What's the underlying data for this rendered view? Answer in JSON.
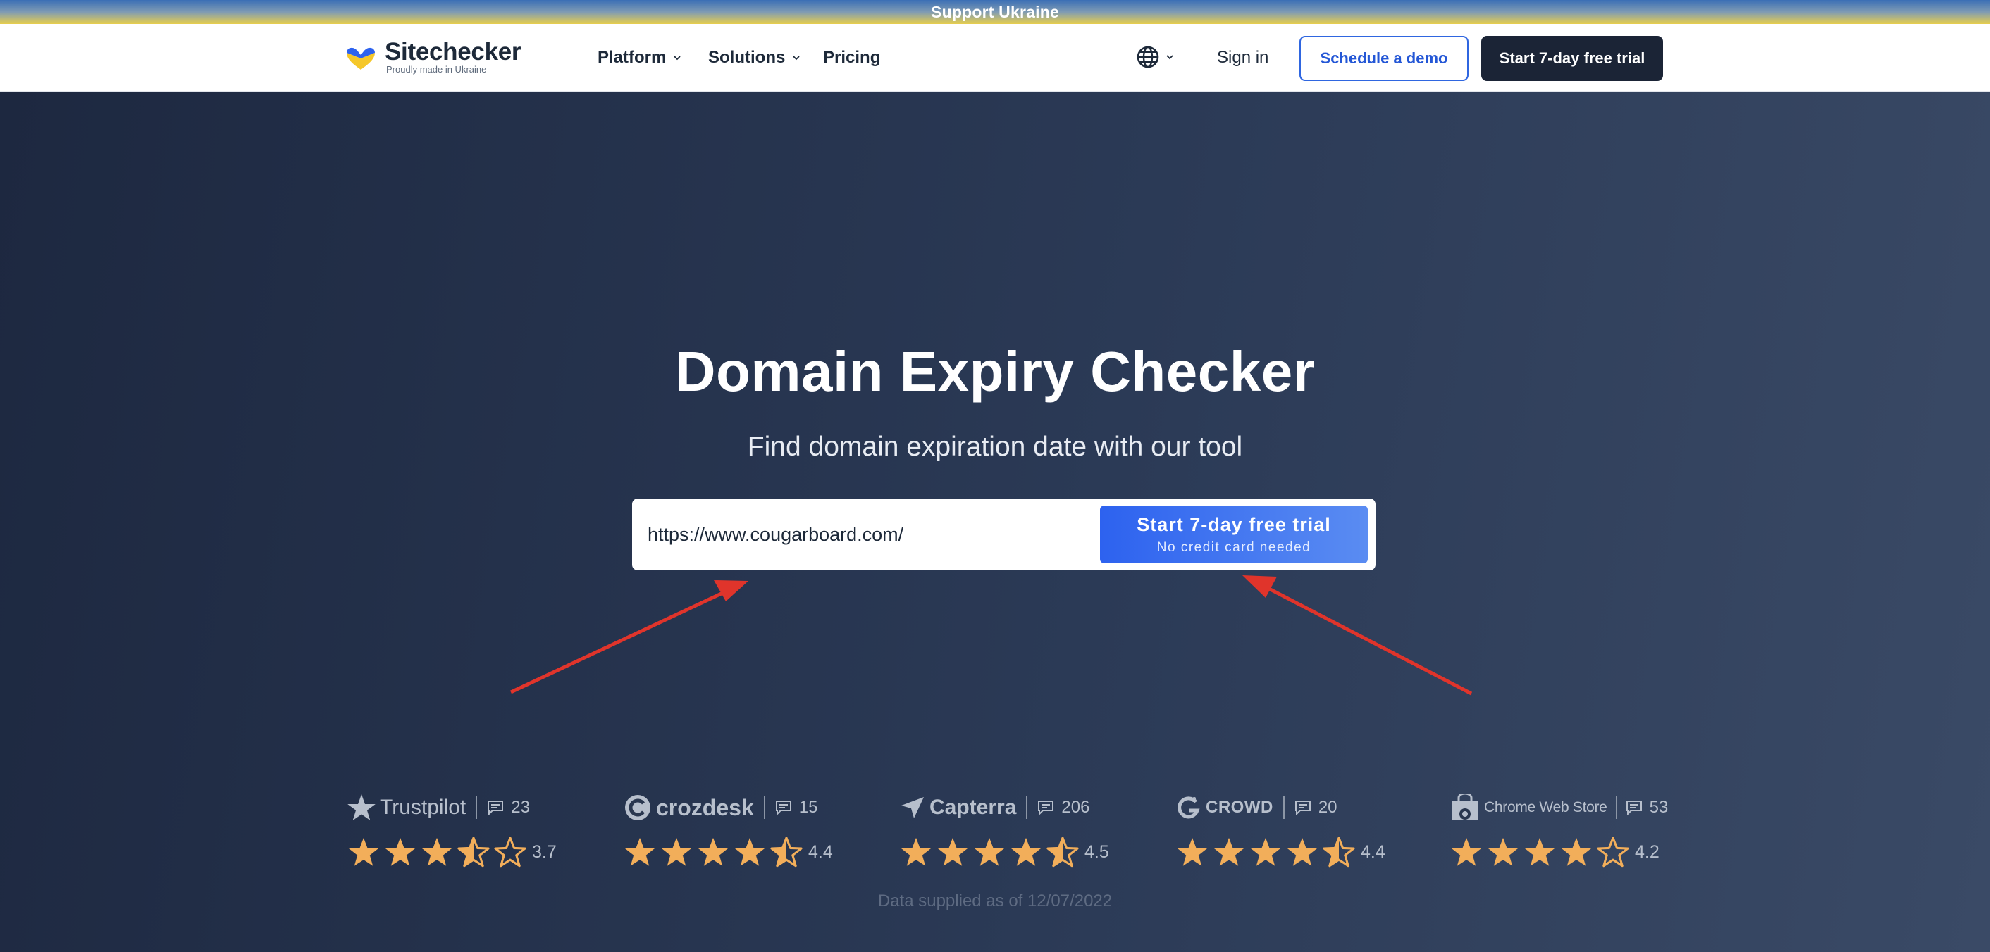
{
  "banner": {
    "text": "Support Ukraine"
  },
  "header": {
    "logo_name": "Sitechecker",
    "logo_tagline": "Proudly made in Ukraine",
    "nav": [
      {
        "label": "Platform",
        "has_dropdown": true
      },
      {
        "label": "Solutions",
        "has_dropdown": true
      },
      {
        "label": "Pricing",
        "has_dropdown": false
      }
    ],
    "language_icon": "globe-icon",
    "signin_label": "Sign in",
    "demo_label": "Schedule a demo",
    "trial_label": "Start 7-day free trial"
  },
  "hero": {
    "title": "Domain Expiry Checker",
    "subtitle": "Find domain expiration date with our tool",
    "input_value": "https://www.cougarboard.com/",
    "button_main": "Start 7-day free trial",
    "button_sub": "No credit card needed"
  },
  "ratings": [
    {
      "brand": "Trustpilot",
      "icon": "trustpilot-star-icon",
      "reviews": "23",
      "score": "3.7",
      "stars": 3.7
    },
    {
      "brand": "crozdesk",
      "icon": "crozdesk-logo-icon",
      "reviews": "15",
      "score": "4.4",
      "stars": 4.4
    },
    {
      "brand": "Capterra",
      "icon": "capterra-logo-icon",
      "reviews": "206",
      "score": "4.5",
      "stars": 4.5
    },
    {
      "brand": "CROWD",
      "icon": "g2-logo-icon",
      "reviews": "20",
      "score": "4.4",
      "stars": 4.4
    },
    {
      "brand": "Chrome Web Store",
      "icon": "chrome-web-store-icon",
      "reviews": "53",
      "score": "4.2",
      "stars": 4.2
    }
  ],
  "footnote": "Data supplied as of 12/07/2022",
  "colors": {
    "navy": "#1b2436",
    "accent_blue": "#2d62ef",
    "star_gold": "#f2ae5a",
    "arrow_red": "#e0342b"
  }
}
